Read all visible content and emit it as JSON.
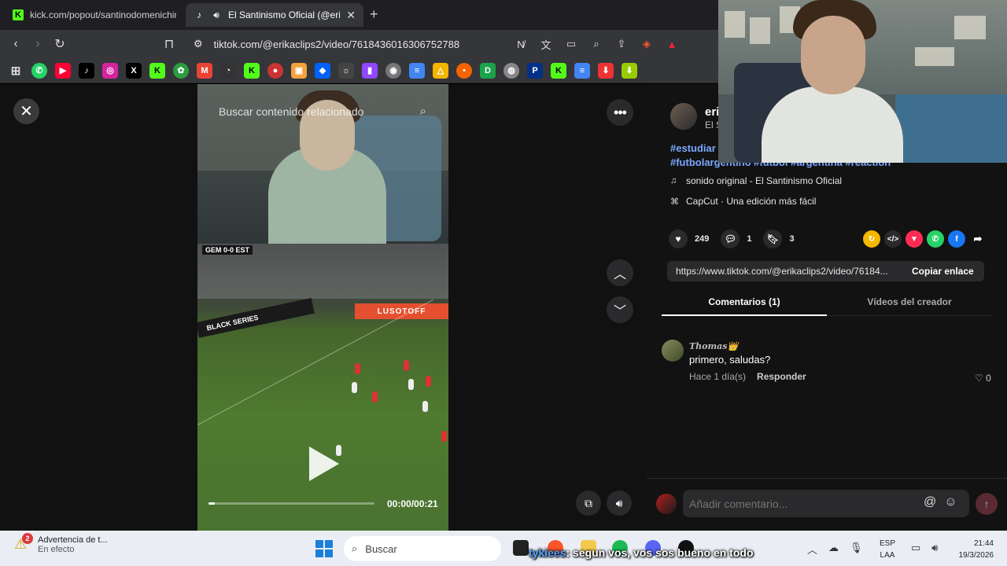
{
  "browser": {
    "tabs": [
      {
        "title": "kick.com/popout/santinodomenichin",
        "active": false
      },
      {
        "title": "El Santinismo Oficial (@erikac",
        "active": true
      }
    ],
    "new_tab": "+",
    "url": "tiktok.com/@erikaclips2/video/7618436016306752788",
    "bookmark_icons": [
      "whatsapp-icon",
      "youtube-icon",
      "tiktok-icon",
      "instagram-icon",
      "x-icon",
      "kick-icon",
      "extension-icon",
      "gmail-icon",
      "github-icon",
      "kick-icon",
      "record-icon",
      "extension-icon",
      "dropbox-icon",
      "extension-icon",
      "twitch-icon",
      "extension-icon",
      "docs-icon",
      "drive-icon",
      "extension-icon",
      "d-icon",
      "globe-icon",
      "paypal-icon",
      "kick-icon",
      "docs-icon",
      "download-icon",
      "arrow-icon"
    ]
  },
  "video": {
    "search_placeholder": "Buscar contenido relacionado",
    "scorebug": "GEM 0-0 EST",
    "ad_text_1": "LUSOTOFF",
    "ad_text_2": "BLACK SERIES",
    "time": "00:00/00:21",
    "progress": 0.04
  },
  "post": {
    "author_name": "eri",
    "author_sub": "El S",
    "hashtags_line1": "#estudiar",
    "hashtags_line2": "#futbolargentino #futbol #argentina #reaction",
    "sound": "sonido original - El Santinismo Oficial",
    "capcut": "CapCut · Una edición más fácil",
    "likes": "249",
    "comments": "1",
    "saves": "3",
    "link": "https://www.tiktok.com/@erikaclips2/video/76184...",
    "copy_label": "Copiar enlace"
  },
  "comment_tabs": {
    "comments": "Comentarios (1)",
    "creator_videos": "Vídeos del creador"
  },
  "comments": [
    {
      "user": "Thomas👑",
      "text": "primero, saludas?",
      "time": "Hace 1 día(s)",
      "reply": "Responder",
      "likes": "0"
    }
  ],
  "comment_input": {
    "placeholder": "Añadir comentario..."
  },
  "taskbar": {
    "notification_title": "Advertencia de t...",
    "notification_sub": "En efecto",
    "notification_badge": "2",
    "search_label": "Buscar",
    "chat_user": "tykiees",
    "chat_text": ": segun vos, vos sos bueno en todo",
    "lang_1": "ESP",
    "lang_2": "LAA",
    "time": "21:44",
    "date": "19/3/2026"
  },
  "colors": {
    "hashtag": "#7aa8ff",
    "kick_green": "#53fc18",
    "panel_bg": "#121212"
  }
}
